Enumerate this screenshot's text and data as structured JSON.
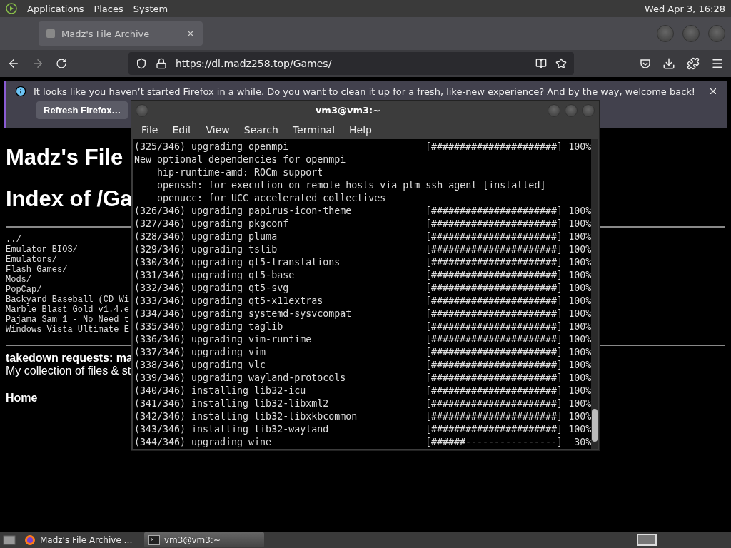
{
  "top_panel": {
    "menus": [
      "Applications",
      "Places",
      "System"
    ],
    "clock": "Wed Apr 3, 16:28"
  },
  "browser": {
    "tabs": [
      {
        "title": "Madz's File Archive",
        "selected": true
      }
    ],
    "url": "https://dl.madz258.top/Games/",
    "notification": {
      "message": "It looks like you haven’t started Firefox in a while. Do you want to clean it up for a fresh, like-new experience? And by the way, welcome back!",
      "button": "Refresh Firefox…"
    },
    "page": {
      "heading": "Madz's File",
      "index_heading": "Index of /Ga",
      "entries": [
        "../",
        "Emulator BIOS/",
        "Emulators/",
        "Flash Games/",
        "Mods/",
        "PopCap/",
        "Backyard Baseball (CD Wi",
        "Marble_Blast_Gold_v1.4.e",
        "Pajama Sam 1 - No Need t",
        "Windows Vista Ultimate E"
      ],
      "takedown": "takedown requests: ma",
      "description": "My collection of files & st",
      "home_link": "Home"
    }
  },
  "terminal": {
    "title": "vm3@vm3:~",
    "menus": [
      "File",
      "Edit",
      "View",
      "Search",
      "Terminal",
      "Help"
    ],
    "lines": [
      {
        "kind": "progress",
        "text": "(325/346) upgrading openmpi",
        "bar": "[######################]",
        "percent": "100%"
      },
      {
        "kind": "plain",
        "text": "New optional dependencies for openmpi"
      },
      {
        "kind": "plain",
        "text": "    hip-runtime-amd: ROCm support"
      },
      {
        "kind": "plain",
        "text": "    openssh: for execution on remote hosts via plm_ssh_agent [installed]"
      },
      {
        "kind": "plain",
        "text": "    openucc: for UCC accelerated collectives"
      },
      {
        "kind": "progress",
        "text": "(326/346) upgrading papirus-icon-theme",
        "bar": "[######################]",
        "percent": "100%"
      },
      {
        "kind": "progress",
        "text": "(327/346) upgrading pkgconf",
        "bar": "[######################]",
        "percent": "100%"
      },
      {
        "kind": "progress",
        "text": "(328/346) upgrading pluma",
        "bar": "[######################]",
        "percent": "100%"
      },
      {
        "kind": "progress",
        "text": "(329/346) upgrading tslib",
        "bar": "[######################]",
        "percent": "100%"
      },
      {
        "kind": "progress",
        "text": "(330/346) upgrading qt5-translations",
        "bar": "[######################]",
        "percent": "100%"
      },
      {
        "kind": "progress",
        "text": "(331/346) upgrading qt5-base",
        "bar": "[######################]",
        "percent": "100%"
      },
      {
        "kind": "progress",
        "text": "(332/346) upgrading qt5-svg",
        "bar": "[######################]",
        "percent": "100%"
      },
      {
        "kind": "progress",
        "text": "(333/346) upgrading qt5-x11extras",
        "bar": "[######################]",
        "percent": "100%"
      },
      {
        "kind": "progress",
        "text": "(334/346) upgrading systemd-sysvcompat",
        "bar": "[######################]",
        "percent": "100%"
      },
      {
        "kind": "progress",
        "text": "(335/346) upgrading taglib",
        "bar": "[######################]",
        "percent": "100%"
      },
      {
        "kind": "progress",
        "text": "(336/346) upgrading vim-runtime",
        "bar": "[######################]",
        "percent": "100%"
      },
      {
        "kind": "progress",
        "text": "(337/346) upgrading vim",
        "bar": "[######################]",
        "percent": "100%"
      },
      {
        "kind": "progress",
        "text": "(338/346) upgrading vlc",
        "bar": "[######################]",
        "percent": "100%"
      },
      {
        "kind": "progress",
        "text": "(339/346) upgrading wayland-protocols",
        "bar": "[######################]",
        "percent": "100%"
      },
      {
        "kind": "progress",
        "text": "(340/346) installing lib32-icu",
        "bar": "[######################]",
        "percent": "100%"
      },
      {
        "kind": "progress",
        "text": "(341/346) installing lib32-libxml2",
        "bar": "[######################]",
        "percent": "100%"
      },
      {
        "kind": "progress",
        "text": "(342/346) installing lib32-libxkbcommon",
        "bar": "[######################]",
        "percent": "100%"
      },
      {
        "kind": "progress",
        "text": "(343/346) installing lib32-wayland",
        "bar": "[######################]",
        "percent": "100%"
      },
      {
        "kind": "progress",
        "text": "(344/346) upgrading wine",
        "bar": "[######----------------]",
        "percent": " 30%"
      }
    ]
  },
  "taskbar": {
    "items": [
      {
        "kind": "browser",
        "label": "Madz's File Archive …",
        "selected": false
      },
      {
        "kind": "terminal",
        "label": "vm3@vm3:~",
        "selected": true
      }
    ]
  }
}
